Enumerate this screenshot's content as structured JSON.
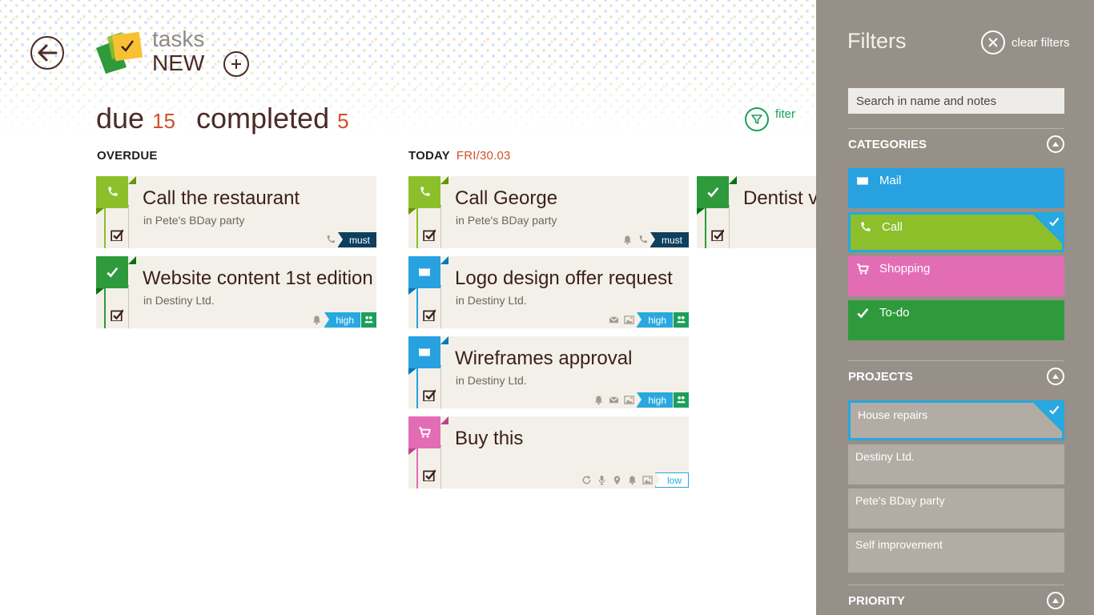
{
  "app": {
    "title": "tasks",
    "subtitle": "NEW"
  },
  "pivots": [
    {
      "label": "due",
      "count": "15"
    },
    {
      "label": "completed",
      "count": "5"
    }
  ],
  "filter_link": {
    "label": "fiter"
  },
  "sections": {
    "overdue": {
      "label": "OVERDUE"
    },
    "today": {
      "label": "TODAY",
      "date": "FRI/30.03"
    }
  },
  "colors": {
    "call": "#8cbf2a",
    "mail": "#27a1e0",
    "shopping": "#e36db5",
    "todo": "#2f9a3c",
    "accent_count": "#d0502a",
    "must": "#0d3f5e",
    "high": "#27a8e0",
    "people": "#1aa05a"
  },
  "tasks": [
    {
      "title": "Call the restaurant",
      "project": "in Pete's BDay party",
      "category": "call",
      "icons": [
        "phone-icon"
      ],
      "priority": "must",
      "shared": false
    },
    {
      "title": "Website content 1st edition",
      "project": "in Destiny Ltd.",
      "category": "todo",
      "icons": [
        "bell-icon"
      ],
      "priority": "high",
      "shared": true
    },
    {
      "title": "Call George",
      "project": "in Pete's BDay party",
      "category": "call",
      "icons": [
        "bell-icon",
        "phone-icon"
      ],
      "priority": "must",
      "shared": false
    },
    {
      "title": "Logo design offer request",
      "project": "in Destiny Ltd.",
      "category": "mail",
      "icons": [
        "mail-icon",
        "image-icon"
      ],
      "priority": "high",
      "shared": true
    },
    {
      "title": "Wireframes approval",
      "project": "in Destiny Ltd.",
      "category": "mail",
      "icons": [
        "bell-icon",
        "mail-icon",
        "image-icon"
      ],
      "priority": "high",
      "shared": true
    },
    {
      "title": "Buy this",
      "project": "",
      "category": "shopping",
      "icons": [
        "repeat-icon",
        "microphone-icon",
        "location-icon",
        "bell-icon",
        "image-icon"
      ],
      "priority": "low",
      "shared": false
    },
    {
      "title": "Dentist vi",
      "project": "",
      "category": "todo",
      "icons": [],
      "priority": "",
      "shared": false
    }
  ],
  "filters": {
    "title": "Filters",
    "clear_label": "clear filters",
    "search_placeholder": "Search in name and notes",
    "categories": {
      "label": "CATEGORIES",
      "items": [
        {
          "label": "Mail",
          "icon": "mail-icon",
          "selected": false
        },
        {
          "label": "Call",
          "icon": "phone-icon",
          "selected": true
        },
        {
          "label": "Shopping",
          "icon": "cart-icon",
          "selected": false
        },
        {
          "label": "To-do",
          "icon": "check-icon",
          "selected": false
        }
      ]
    },
    "projects": {
      "label": "PROJECTS",
      "items": [
        {
          "label": "House repairs",
          "selected": true
        },
        {
          "label": "Destiny Ltd.",
          "selected": false
        },
        {
          "label": "Pete's BDay party",
          "selected": false
        },
        {
          "label": "Self improvement",
          "selected": false
        }
      ]
    },
    "priority": {
      "label": "PRIORITY"
    }
  }
}
